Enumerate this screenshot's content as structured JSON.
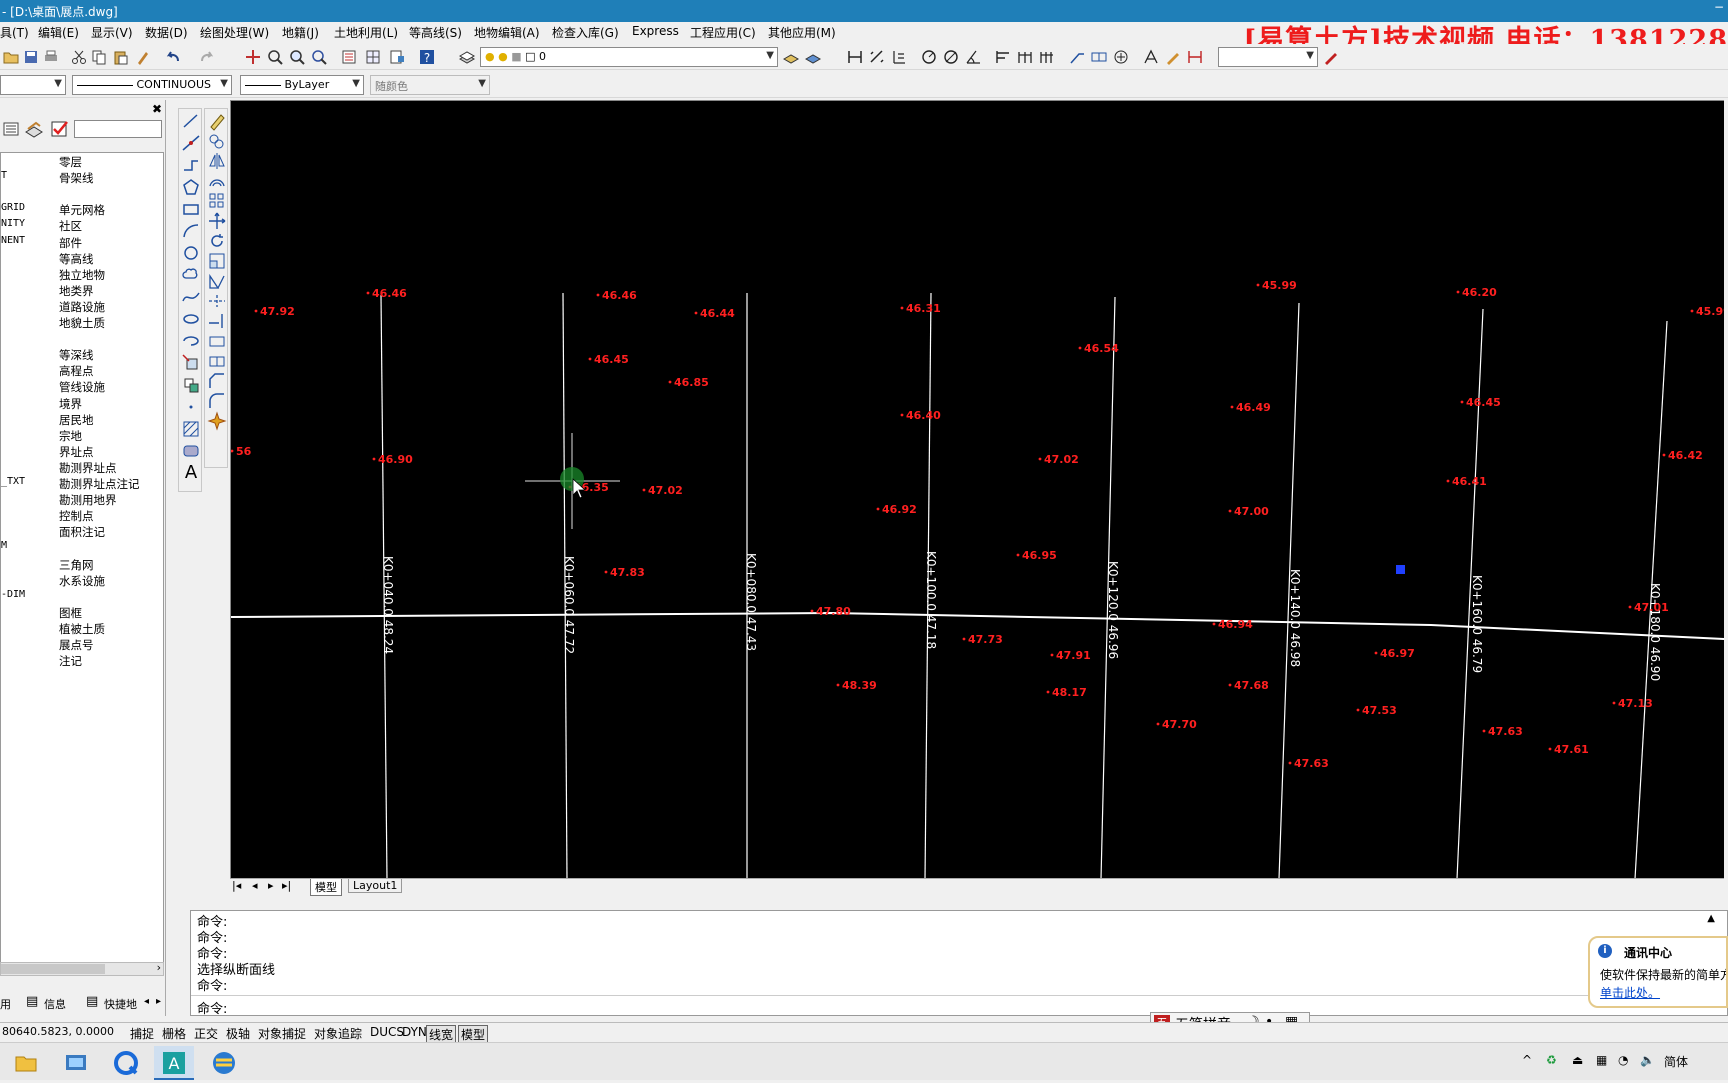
{
  "window": {
    "title": "- [D:\\桌面\\展点.dwg]"
  },
  "banner": "[易算土方]技术视频  电话：1381228",
  "menu": [
    "具(T)",
    "编辑(E)",
    "显示(V)",
    "数据(D)",
    "绘图处理(W)",
    "地籍(J)",
    "土地利用(L)",
    "等高线(S)",
    "地物编辑(A)",
    "检查入库(G)",
    "Express",
    "工程应用(C)",
    "其他应用(M)"
  ],
  "toolbar": {
    "layer_value": "0"
  },
  "properties": {
    "linetype": "CONTINUOUS",
    "lineweight": "ByLayer",
    "color": "随颜色"
  },
  "layers": [
    {
      "code": "",
      "name": "零层"
    },
    {
      "code": "T",
      "name": "骨架线"
    },
    {
      "code": "",
      "name": ""
    },
    {
      "code": "GRID",
      "name": "单元网格"
    },
    {
      "code": "NITY",
      "name": "社区"
    },
    {
      "code": "NENT",
      "name": "部件"
    },
    {
      "code": "",
      "name": "等高线"
    },
    {
      "code": "",
      "name": "独立地物"
    },
    {
      "code": "",
      "name": "地类界"
    },
    {
      "code": "",
      "name": "道路设施"
    },
    {
      "code": "",
      "name": "地貌土质"
    },
    {
      "code": "",
      "name": ""
    },
    {
      "code": "",
      "name": "等深线"
    },
    {
      "code": "",
      "name": "高程点"
    },
    {
      "code": "",
      "name": "管线设施"
    },
    {
      "code": "",
      "name": "境界"
    },
    {
      "code": "",
      "name": "居民地"
    },
    {
      "code": "",
      "name": "宗地"
    },
    {
      "code": "",
      "name": "界址点"
    },
    {
      "code": "",
      "name": "勘测界址点"
    },
    {
      "code": "_TXT",
      "name": "勘测界址点注记"
    },
    {
      "code": "",
      "name": "勘测用地界"
    },
    {
      "code": "",
      "name": "控制点"
    },
    {
      "code": "",
      "name": "面积注记"
    },
    {
      "code": "M",
      "name": ""
    },
    {
      "code": "",
      "name": "三角网"
    },
    {
      "code": "",
      "name": "水系设施"
    },
    {
      "code": "-DIM",
      "name": ""
    },
    {
      "code": "",
      "name": "图框"
    },
    {
      "code": "",
      "name": "植被土质"
    },
    {
      "code": "",
      "name": "展点号"
    },
    {
      "code": "",
      "name": "注记"
    }
  ],
  "left_tabs": [
    "用",
    "信息",
    "快捷地"
  ],
  "stations": [
    "K0+040.0 48.24",
    "K0+060.0 47.72",
    "K0+080.0 47.43",
    "K0+100.0 47.18",
    "K0+120.0 46.96",
    "K0+140.0 46.98",
    "K0+160.0 46.79",
    "K0+180.0 46.90"
  ],
  "points": [
    {
      "label": "47.92",
      "x": 0,
      "y": 0
    }
  ],
  "elevations": [
    "47.92",
    "46.46",
    "46.46",
    "46.44",
    "46.31",
    "46.54",
    "45.99",
    "46.20",
    "45.99",
    "46.45",
    "46.85",
    "46.40",
    "46.49",
    "46.45",
    "56",
    "46.90",
    "46.35",
    "47.02",
    "47.02",
    "46.92",
    "47.00",
    "46.41",
    "46.42",
    "47.83",
    "46.95",
    "47.80",
    "47.73",
    "47.91",
    "46.94",
    "46.97",
    "47.01",
    "48.39",
    "48.17",
    "47.68",
    "47.53",
    "47.13",
    "47.70",
    "47.63",
    "47.63",
    "47.61"
  ],
  "layout_tabs": [
    "模型",
    "Layout1"
  ],
  "command": {
    "lines": [
      "命令:",
      "命令:",
      "命令:",
      "选择纵断面线",
      "命令:"
    ],
    "prompt": "命令:"
  },
  "status": {
    "coords": "80640.5823,  0.0000",
    "buttons": [
      "捕捉",
      "栅格",
      "正交",
      "极轴",
      "对象捕捉",
      "对象追踪",
      "DUCS",
      "DYN",
      "线宽",
      "模型"
    ]
  },
  "ime": {
    "label": "五笔拼音"
  },
  "notify": {
    "title": "通讯中心",
    "text": "使软件保持最新的简单方",
    "link": "单击此处。"
  },
  "tray": {
    "lang": "简体"
  }
}
